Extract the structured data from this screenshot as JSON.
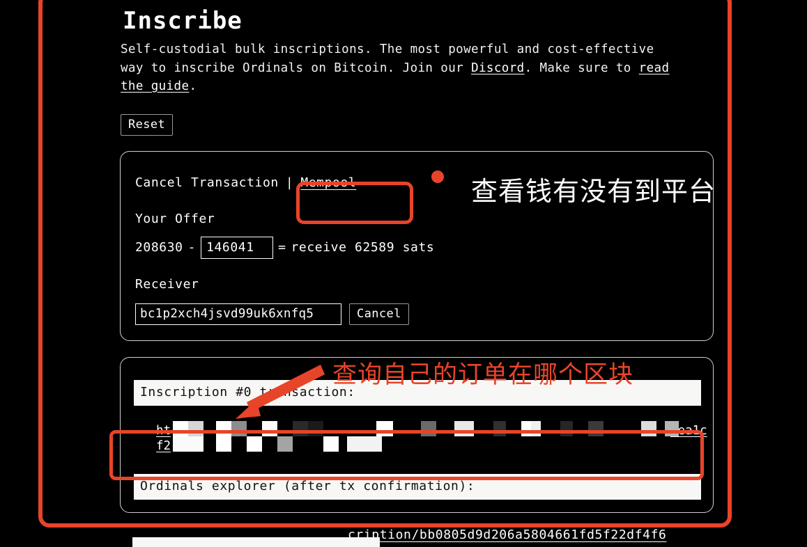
{
  "page": {
    "title": "Inscribe",
    "lede_parts": {
      "before_discord": "Self-custodial bulk inscriptions. The most powerful and cost-effective way to inscribe Ordinals on Bitcoin. Join our ",
      "discord_link": "Discord",
      "middle": ". Make sure to ",
      "guide_link": "read the guide",
      "after_guide": "."
    },
    "reset_button": "Reset"
  },
  "cancel_card": {
    "heading": "Cancel Transaction",
    "separator": "|",
    "mempool_link": "Mempool",
    "offer_label": "Your Offer",
    "offer_total": "208630",
    "offer_minus": "-",
    "offer_fee_value": "146041",
    "offer_equals": "=",
    "offer_result": "receive 62589 sats",
    "receiver_label": "Receiver",
    "receiver_address": "bc1p2xch4jsvd99uk6xnfq5",
    "cancel_button": "Cancel"
  },
  "tx_card": {
    "inscription_tx_label": "Inscription #0 transaction:",
    "redacted_link_prefix_line1": "ht",
    "redacted_link_prefix_line2": "f2",
    "redacted_link_suffix": "eea1c",
    "ordinals_explorer_label": "Ordinals explorer (after tx confirmation):",
    "ordinals_url_visible": "cription/bb0805d9d206a5804661fd5f22df4f6"
  },
  "annotations": {
    "color_red": "#e8442a",
    "note_top_right": "查看钱有没有到平台",
    "note_middle_red": "查询自己的订单在哪个区块",
    "dot_icon": "red-dot-marker",
    "arrow_icon": "red-arrow-pointing-down-left",
    "box_big": "outer-region-highlight",
    "box_mempool": "mempool-link-highlight",
    "box_url": "transaction-url-highlight"
  }
}
